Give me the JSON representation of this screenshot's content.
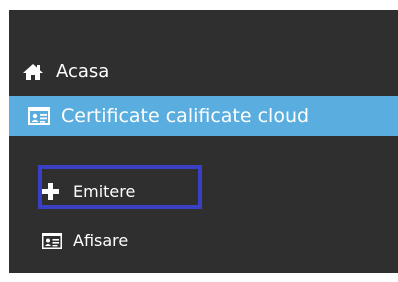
{
  "sidebar": {
    "items": [
      {
        "label": "Acasa",
        "icon": "home-icon"
      },
      {
        "label": "Certificate calificate cloud",
        "icon": "id-card-icon",
        "active": true,
        "active_color": "#5aaedf"
      },
      {
        "label": "Emitere",
        "icon": "plus-icon",
        "highlighted": true,
        "highlight_color": "#3a3fc4"
      },
      {
        "label": "Afisare",
        "icon": "id-card-icon"
      }
    ]
  },
  "colors": {
    "sidebar_bg": "#2f2f2f",
    "active_bg": "#5aaedf",
    "highlight_border": "#3a3fc4",
    "text": "#ffffff"
  }
}
